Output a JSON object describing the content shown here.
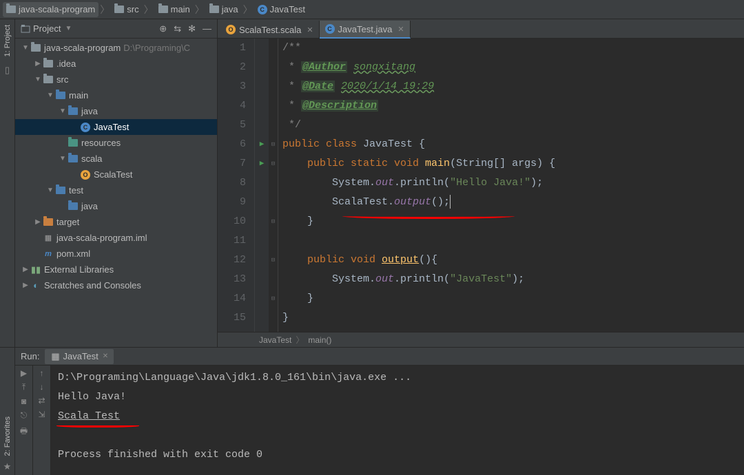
{
  "breadcrumb": {
    "root": "java-scala-program",
    "parts": [
      "src",
      "main",
      "java"
    ],
    "file": "JavaTest"
  },
  "projectPanel": {
    "title": "Project",
    "tree": [
      {
        "l": 0,
        "a": "▼",
        "icon": "folder",
        "label": "java-scala-program",
        "suffix": "D:\\Programing\\C"
      },
      {
        "l": 1,
        "a": "▶",
        "icon": "folder",
        "label": ".idea"
      },
      {
        "l": 1,
        "a": "▼",
        "icon": "folder",
        "label": "src"
      },
      {
        "l": 2,
        "a": "▼",
        "icon": "folder-blue",
        "label": "main"
      },
      {
        "l": 3,
        "a": "▼",
        "icon": "folder-blue",
        "label": "java"
      },
      {
        "l": 4,
        "a": "",
        "icon": "java",
        "label": "JavaTest",
        "selected": true
      },
      {
        "l": 3,
        "a": "",
        "icon": "folder-teal",
        "label": "resources"
      },
      {
        "l": 3,
        "a": "▼",
        "icon": "folder-blue",
        "label": "scala"
      },
      {
        "l": 4,
        "a": "",
        "icon": "scala",
        "label": "ScalaTest"
      },
      {
        "l": 2,
        "a": "▼",
        "icon": "folder-blue",
        "label": "test"
      },
      {
        "l": 3,
        "a": "",
        "icon": "folder-blue",
        "label": "java"
      },
      {
        "l": 1,
        "a": "▶",
        "icon": "folder-orange",
        "label": "target"
      },
      {
        "l": 1,
        "a": "",
        "icon": "iml",
        "label": "java-scala-program.iml"
      },
      {
        "l": 1,
        "a": "",
        "icon": "maven",
        "label": "pom.xml"
      },
      {
        "l": 0,
        "a": "▶",
        "icon": "lib",
        "label": "External Libraries"
      },
      {
        "l": 0,
        "a": "▶",
        "icon": "scratch",
        "label": "Scratches and Consoles"
      }
    ]
  },
  "tabs": [
    {
      "icon": "scala",
      "label": "ScalaTest.scala",
      "active": false
    },
    {
      "icon": "java",
      "label": "JavaTest.java",
      "active": true
    }
  ],
  "code": {
    "lines": [
      {
        "n": 1,
        "html": "<span class='com'>/**</span>"
      },
      {
        "n": 2,
        "html": "<span class='com'> * </span><span class='doctag'>@Author</span> <span class='docval'>songxitang</span>"
      },
      {
        "n": 3,
        "html": "<span class='com'> * </span><span class='doctag'>@Date</span> <span class='docval'>2020/1/14 19:29</span>"
      },
      {
        "n": 4,
        "html": "<span class='com'> * </span><span class='doctag'>@Description</span>"
      },
      {
        "n": 5,
        "html": "<span class='com'> */</span>"
      },
      {
        "n": 6,
        "run": true,
        "fold": "⊟",
        "html": "<span class='kw'>public class </span><span class='cls'>JavaTest {</span>"
      },
      {
        "n": 7,
        "run": true,
        "fold": "⊟",
        "html": "    <span class='kw'>public static void </span><span class='mth'>main</span><span class='txt'>(String[] args) {</span>"
      },
      {
        "n": 8,
        "html": "        <span class='txt'>System.</span><span class='fld'>out</span><span class='txt'>.println(</span><span class='str'>\"Hello Java!\"</span><span class='txt'>);</span>"
      },
      {
        "n": 9,
        "html": "        <span class='txt'>ScalaTest.</span><span class='fld'>output</span><span class='txt'>();</span><span class='cursor'></span>"
      },
      {
        "n": 10,
        "fold": "⊟",
        "html": "    <span class='txt'>}</span>"
      },
      {
        "n": 11,
        "html": ""
      },
      {
        "n": 12,
        "fold": "⊟",
        "html": "    <span class='kw'>public void </span><span class='mthu'>output</span><span class='txt'>(){</span>"
      },
      {
        "n": 13,
        "html": "        <span class='txt'>System.</span><span class='fld'>out</span><span class='txt'>.println(</span><span class='str'>\"JavaTest\"</span><span class='txt'>);</span>"
      },
      {
        "n": 14,
        "fold": "⊟",
        "html": "    <span class='txt'>}</span>"
      },
      {
        "n": 15,
        "html": "<span class='txt'>}</span>"
      }
    ]
  },
  "editorBreadcrumb": {
    "class": "JavaTest",
    "method": "main()"
  },
  "runPanel": {
    "title": "Run:",
    "tab": "JavaTest",
    "console": [
      "D:\\Programing\\Language\\Java\\jdk1.8.0_161\\bin\\java.exe ...",
      "Hello Java!",
      "Scala Test",
      "",
      "Process finished with exit code 0"
    ]
  },
  "sidebarLeft": {
    "project": "1: Project",
    "favorites": "2: Favorites"
  }
}
